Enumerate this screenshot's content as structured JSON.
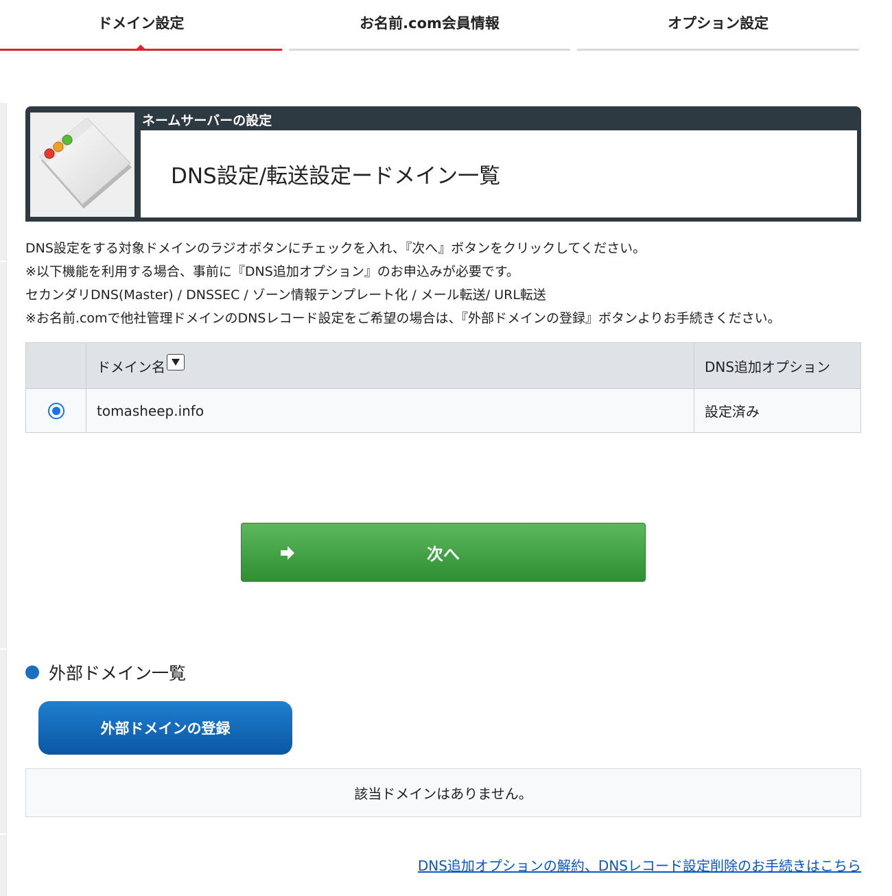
{
  "tabs": [
    {
      "label": "ドメイン設定",
      "active": true
    },
    {
      "label": "お名前.com会員情報",
      "active": false
    },
    {
      "label": "オプション設定",
      "active": false
    }
  ],
  "header": {
    "subtitle": "ネームサーバーの設定",
    "title": "DNS設定/転送設定ードメイン一覧",
    "icon": "browser-window-icon"
  },
  "description": [
    "DNS設定をする対象ドメインのラジオボタンにチェックを入れ、『次へ』ボタンをクリックしてください。",
    "※以下機能を利用する場合、事前に『DNS追加オプション』のお申込みが必要です。",
    "セカンダリDNS(Master) / DNSSEC / ゾーン情報テンプレート化 / メール転送/ URL転送",
    "※お名前.comで他社管理ドメインのDNSレコード設定をご希望の場合は、『外部ドメインの登録』ボタンよりお手続きください。"
  ],
  "domain_table": {
    "headers": [
      "",
      "ドメイン名",
      "DNS追加オプション"
    ],
    "rows": [
      {
        "selected": true,
        "domain": "tomasheep.info",
        "dns_option": "設定済み"
      }
    ]
  },
  "next_button": {
    "label": "次へ",
    "icon": "arrow-right-icon"
  },
  "external": {
    "heading": "外部ドメイン一覧",
    "register_button": "外部ドメインの登録",
    "empty_message": "該当ドメインはありません。"
  },
  "footer_link": "DNS追加オプションの解約、DNSレコード設定削除のお手続きはこちら",
  "colors": {
    "active_tab": "#d7262c",
    "header_bg": "#2d3a41",
    "next_button": "#3fa443",
    "primary_blue": "#0a66bf",
    "link": "#0a56c2"
  }
}
